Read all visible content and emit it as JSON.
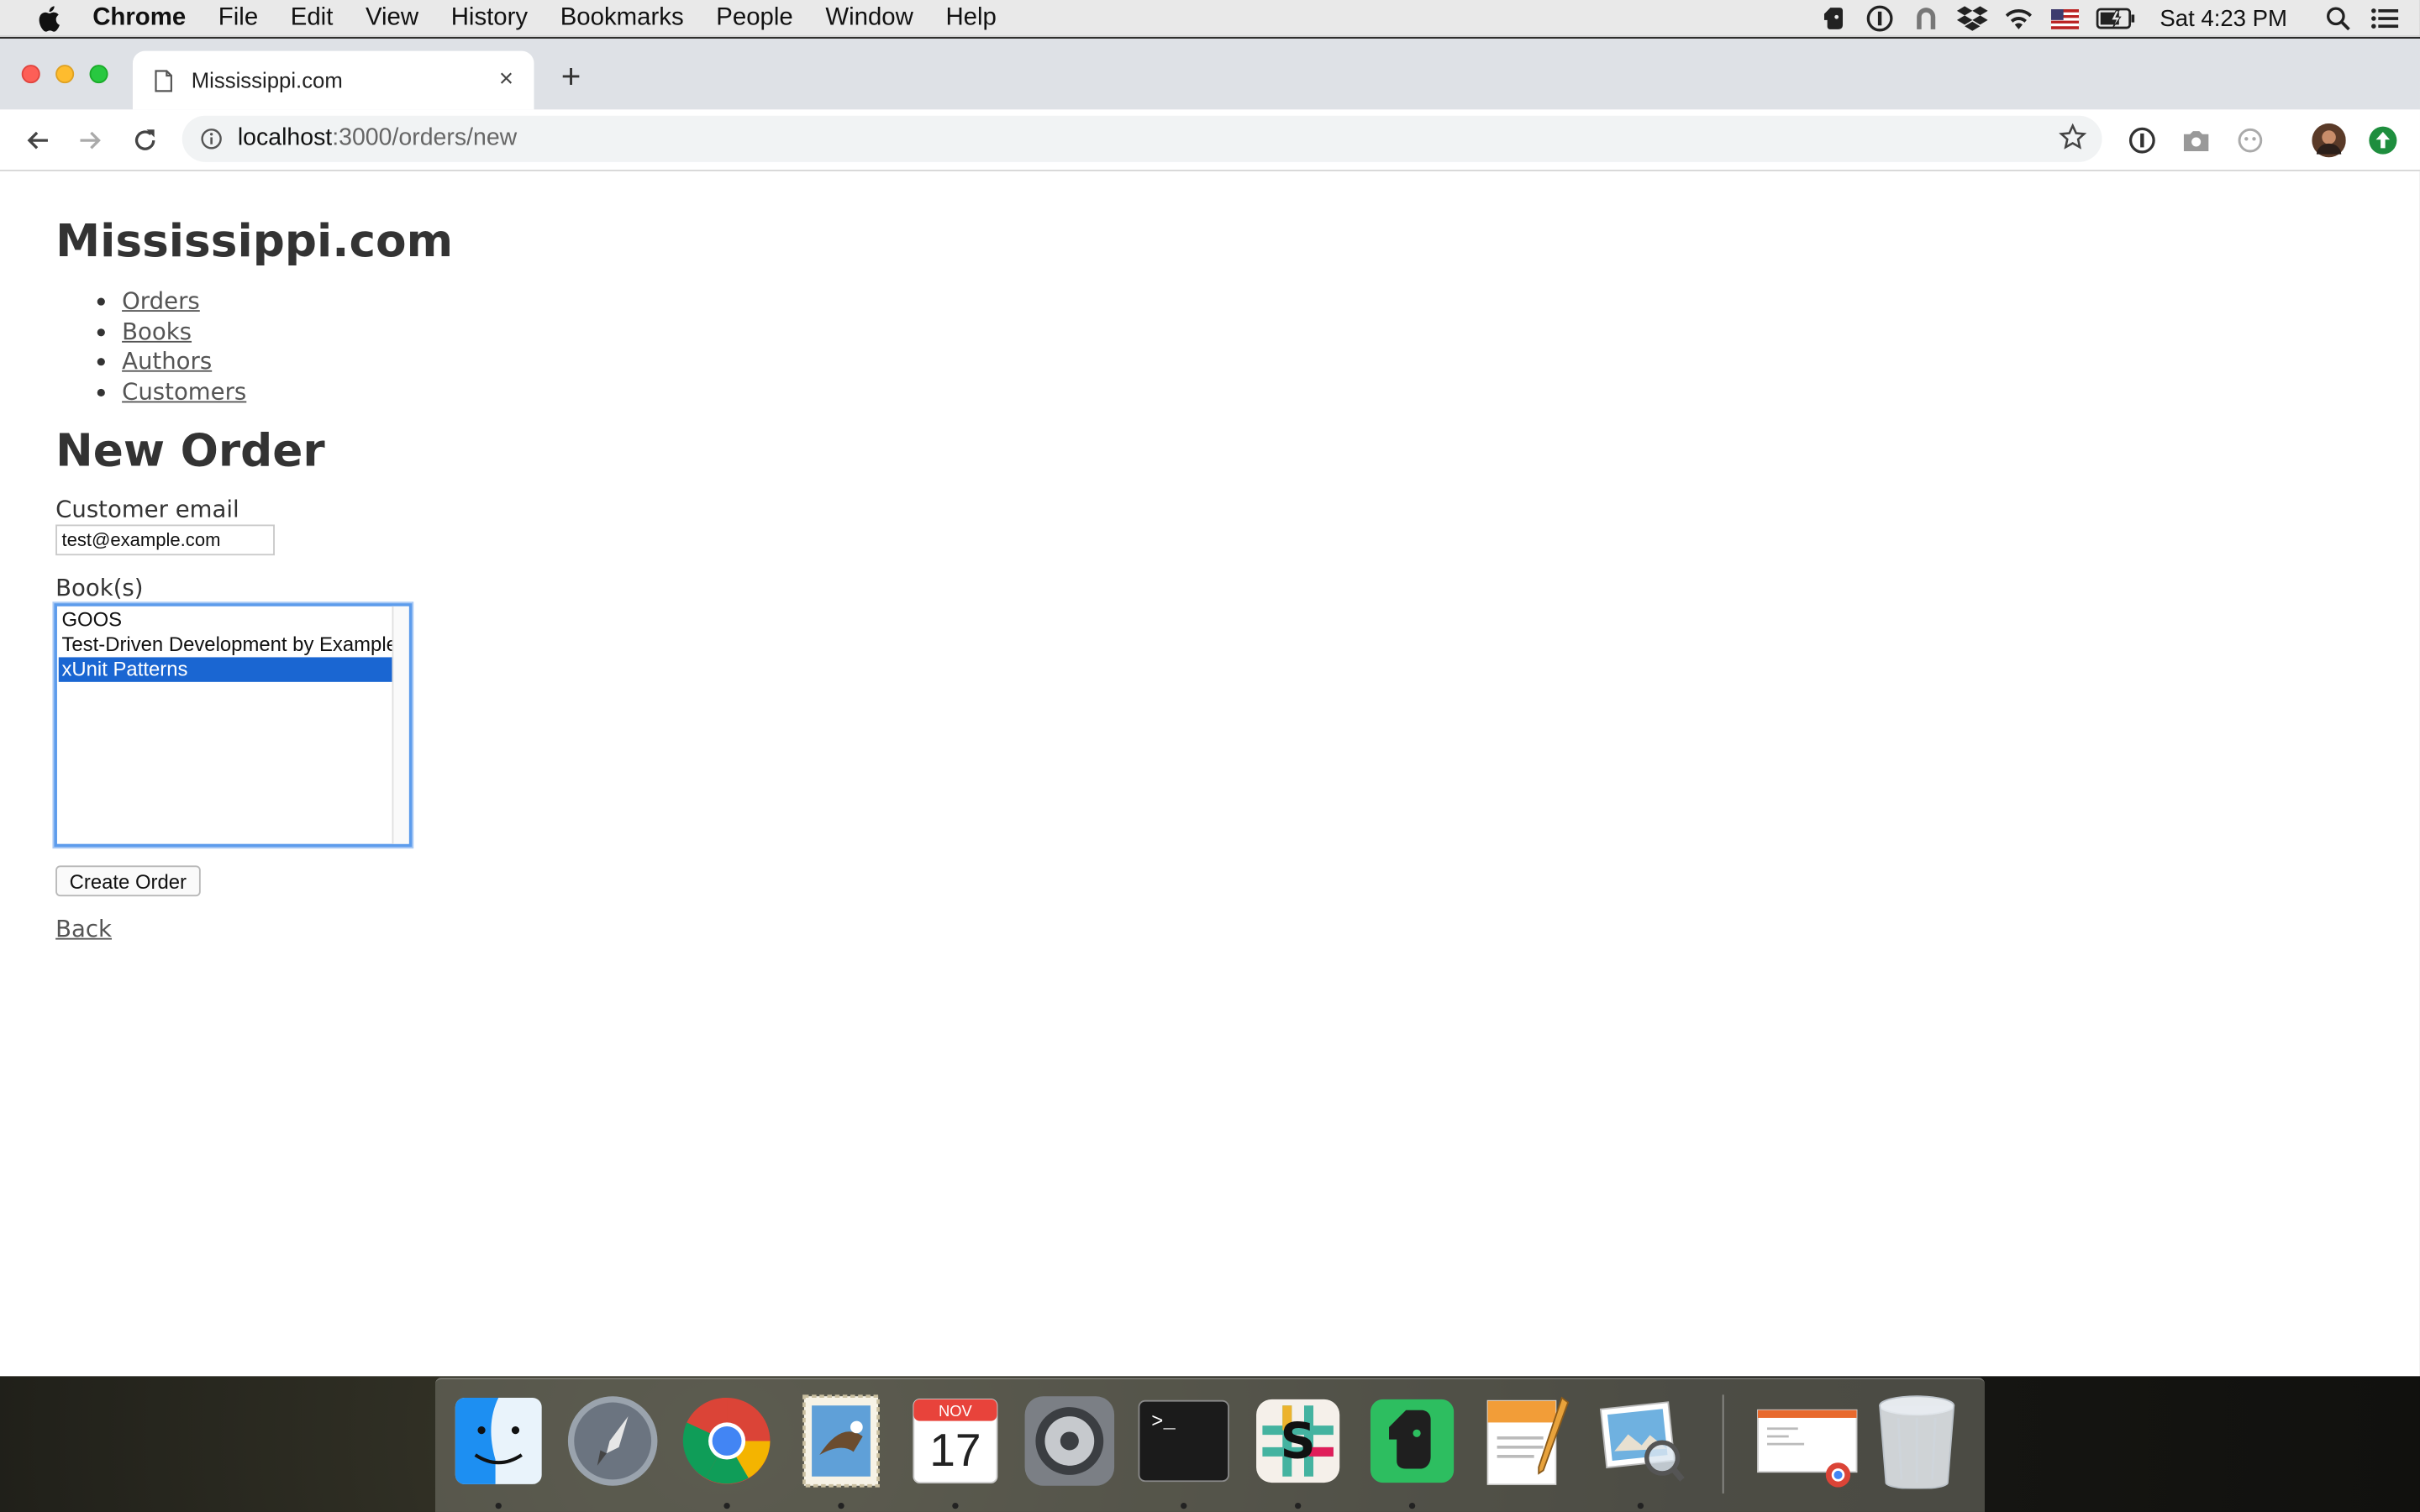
{
  "menubar": {
    "app": "Chrome",
    "items": [
      "File",
      "Edit",
      "View",
      "History",
      "Bookmarks",
      "People",
      "Window",
      "Help"
    ],
    "clock": "Sat 4:23 PM",
    "status_icons": [
      "evernote-icon",
      "1password-icon",
      "alfred-icon",
      "dropbox-icon",
      "wifi-icon",
      "us-flag-icon",
      "battery-icon",
      "spotlight-icon",
      "notification-center-icon"
    ]
  },
  "browser": {
    "tab_title": "Mississippi.com",
    "close_glyph": "×",
    "newtab_glyph": "+",
    "url_host": "localhost",
    "url_path": ":3000/orders/new"
  },
  "page": {
    "site_title": "Mississippi.com",
    "nav": [
      "Orders",
      "Books",
      "Authors",
      "Customers"
    ],
    "heading": "New Order",
    "email_label": "Customer email",
    "email_value": "test@example.com",
    "books_label": "Book(s)",
    "book_options": [
      "GOOS",
      "Test-Driven Development by Example",
      "xUnit Patterns"
    ],
    "selected_book": "xUnit Patterns",
    "submit_label": "Create Order",
    "back_label": "Back"
  },
  "dock": {
    "apps": [
      "finder-icon",
      "launchpad-icon",
      "chrome-icon",
      "mail-icon",
      "calendar-icon",
      "system-preferences-icon",
      "terminal-icon",
      "slack-icon",
      "evernote-icon",
      "pages-icon",
      "preview-icon",
      "chrome-window-icon",
      "trash-icon"
    ],
    "calendar_month": "NOV",
    "calendar_day": "17",
    "terminal_prompt": ">_"
  },
  "colors": {
    "selection": "#1a66d2",
    "focus_ring": "#5d9cec",
    "tab_strip": "#dee1e6"
  }
}
